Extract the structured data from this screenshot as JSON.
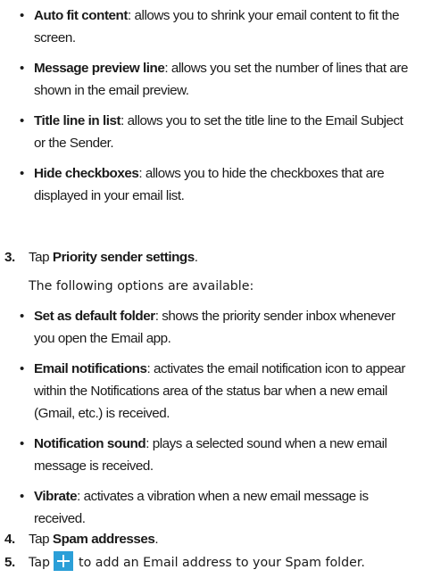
{
  "bullets_a": [
    {
      "term": "Auto fit content",
      "desc": ": allows you to shrink your email content to fit the screen."
    },
    {
      "term": "Message preview line",
      "desc": ": allows you set the number of lines that are shown in the email preview."
    },
    {
      "term": "Title line in list",
      "desc": ": allows you to set the title line to the Email Subject or the Sender."
    },
    {
      "term": "Hide checkboxes",
      "desc": ": allows you to hide the checkboxes that are displayed in your email list."
    }
  ],
  "step3": {
    "num": "3.",
    "prefix": "Tap ",
    "term": "Priority sender settings",
    "suffix": "."
  },
  "intro": "The following options are available:",
  "bullets_b": [
    {
      "term": "Set as default folder",
      "desc": ": shows the priority sender inbox whenever you open the Email app."
    },
    {
      "term": "Email notifications",
      "desc": ": activates the email notification icon to appear within the Notifications area of the status bar when a new email (Gmail, etc.) is received."
    },
    {
      "term": "Notification sound",
      "desc": ": plays a selected sound when a new email message is received."
    },
    {
      "term": "Vibrate",
      "desc": ": activates a vibration when a new email message is received."
    }
  ],
  "step4": {
    "num": "4.",
    "prefix": "Tap ",
    "term": "Spam addresses",
    "suffix": "."
  },
  "step5": {
    "num": "5.",
    "prefix": "Tap",
    "suffix": "to add an Email address to your Spam folder."
  },
  "icons": {
    "plus": "plus-icon",
    "bullet": "bullet-dot"
  },
  "colors": {
    "plus_icon_bg": "#2b9fd8"
  }
}
